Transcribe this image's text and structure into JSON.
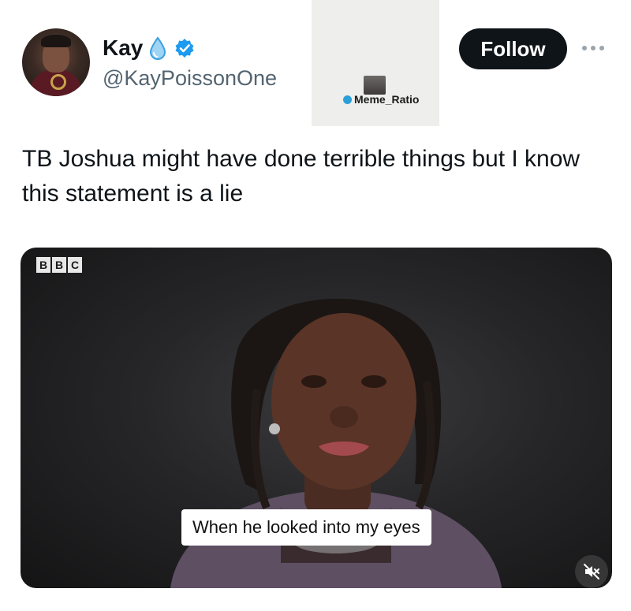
{
  "user": {
    "display_name": "Kay",
    "handle": "@KayPoissonOne",
    "avatar_icon": "avatar-photo",
    "emoji_icon": "droplet-icon",
    "verified_icon": "verified-badge-icon",
    "verified_color": "#1d9bf0"
  },
  "watermark": {
    "text": "Meme_Ratio"
  },
  "actions": {
    "follow_label": "Follow",
    "more_icon": "more-options-icon"
  },
  "tweet": {
    "text": "TB Joshua might have done terrible things but I know this statement is a lie"
  },
  "media": {
    "broadcaster_letters": [
      "B",
      "B",
      "C"
    ],
    "subtitle": "When he looked into my eyes",
    "mute_icon": "muted-speaker-icon"
  },
  "colors": {
    "text_primary": "#0f1419",
    "text_secondary": "#536471",
    "button_bg": "#0f1419",
    "button_text": "#ffffff"
  }
}
